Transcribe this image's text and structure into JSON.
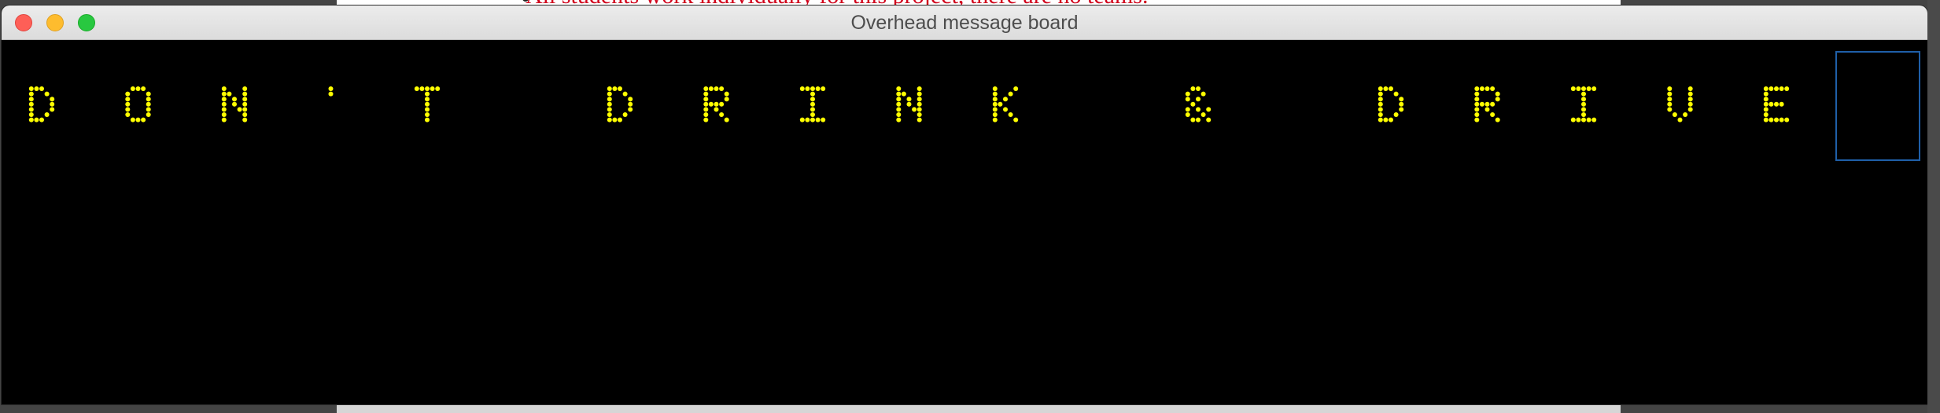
{
  "background_document": {
    "text": "All students work individually for this project, there are no teams."
  },
  "window": {
    "title": "Overhead message board",
    "controls": {
      "close": "close-button",
      "minimize": "minimize-button",
      "maximize": "maximize-button"
    }
  },
  "board": {
    "characters": [
      "D",
      "O",
      "N",
      "'",
      "T",
      " ",
      "D",
      "R",
      "I",
      "N",
      "K",
      " ",
      "&",
      " ",
      "D",
      "R",
      "I",
      "V",
      "E"
    ],
    "led_color": "#ffff00",
    "background_color": "#000000",
    "cursor_box_color": "#1f5fa8"
  }
}
